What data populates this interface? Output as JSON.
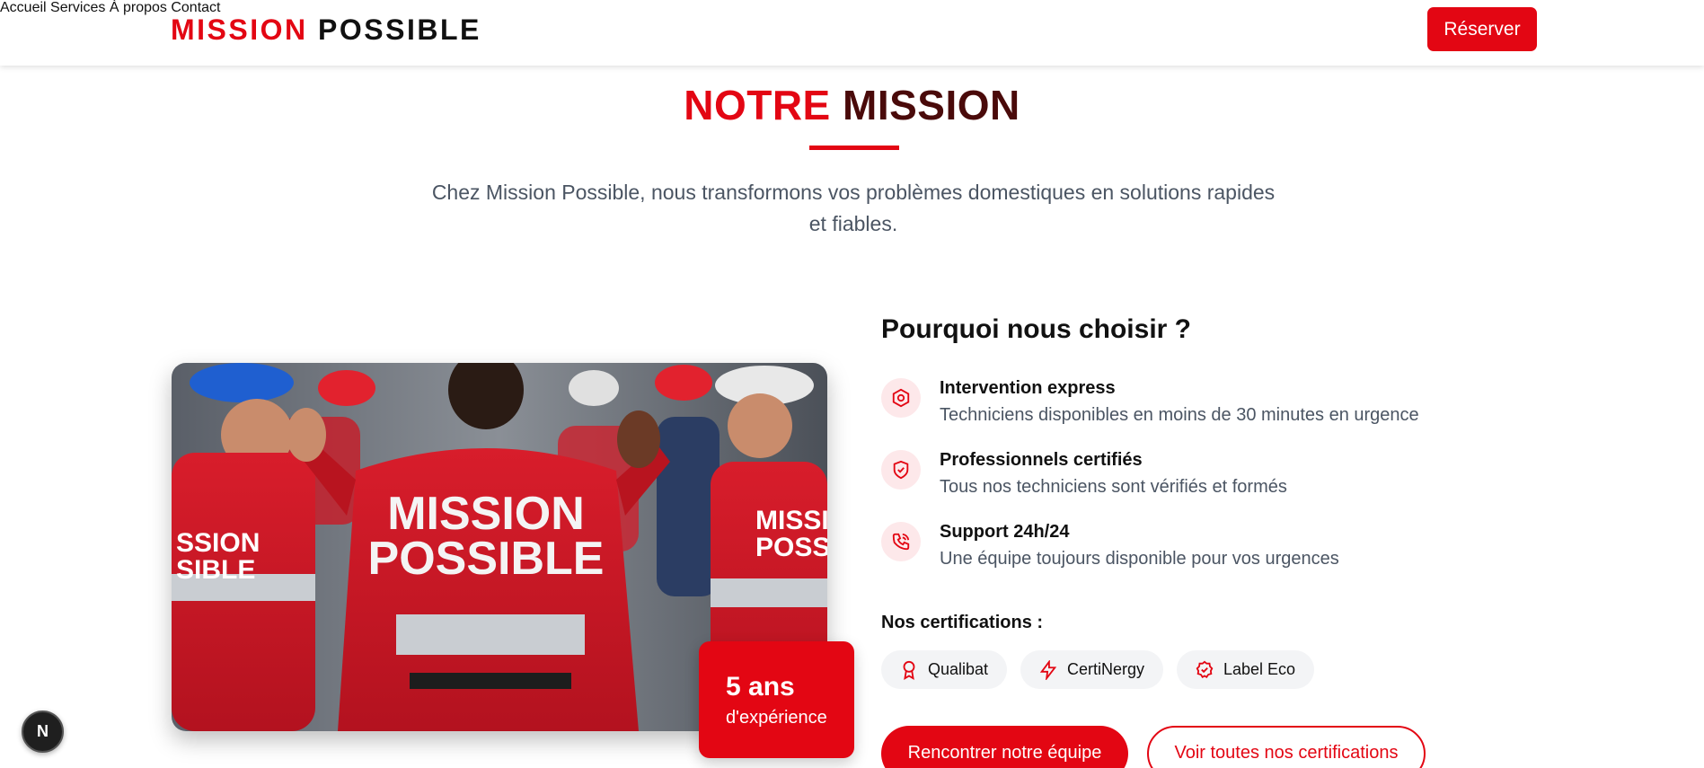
{
  "header": {
    "logo_part1": "MISSION",
    "logo_part2": "POSSIBLE",
    "nav": [
      "Accueil",
      "Services",
      "À propos",
      "Contact"
    ],
    "reserve_label": "Réserver"
  },
  "mission": {
    "title_part1": "NOTRE",
    "title_part2": "MISSION",
    "intro": "Chez Mission Possible, nous transformons vos problèmes domestiques en solutions rapides et fiables."
  },
  "photo": {
    "shirt_text_line1": "MISSION",
    "shirt_text_line2": "POSSIBLE",
    "left_shirt_text_line1": "SSION",
    "left_shirt_text_line2": "SIBLE",
    "right_shirt_text_line1": "MISSIO",
    "right_shirt_text_line2": "POSSIB"
  },
  "experience": {
    "years": "5 ans",
    "label": "d'expérience"
  },
  "why": {
    "title": "Pourquoi nous choisir ?",
    "features": [
      {
        "title": "Intervention express",
        "desc": "Techniciens disponibles en moins de 30 minutes en urgence",
        "icon": "hexagon-gear-icon"
      },
      {
        "title": "Professionnels certifiés",
        "desc": "Tous nos techniciens sont vérifiés et formés",
        "icon": "shield-check-icon"
      },
      {
        "title": "Support 24h/24",
        "desc": "Une équipe toujours disponible pour vos urgences",
        "icon": "phone-call-icon"
      }
    ]
  },
  "certifications": {
    "title": "Nos certifications :",
    "items": [
      {
        "label": "Qualibat",
        "icon": "award-icon"
      },
      {
        "label": "CertiNergy",
        "icon": "lightning-icon"
      },
      {
        "label": "Label Eco",
        "icon": "badge-check-icon"
      }
    ]
  },
  "buttons": {
    "primary": "Rencontrer notre équipe",
    "secondary": "Voir toutes nos certifications"
  },
  "dev_badge": "N",
  "colors": {
    "accent": "#e30613",
    "dark_title": "#4a0a0a",
    "muted_text": "#4b5563",
    "icon_bg": "#fde8ea"
  }
}
